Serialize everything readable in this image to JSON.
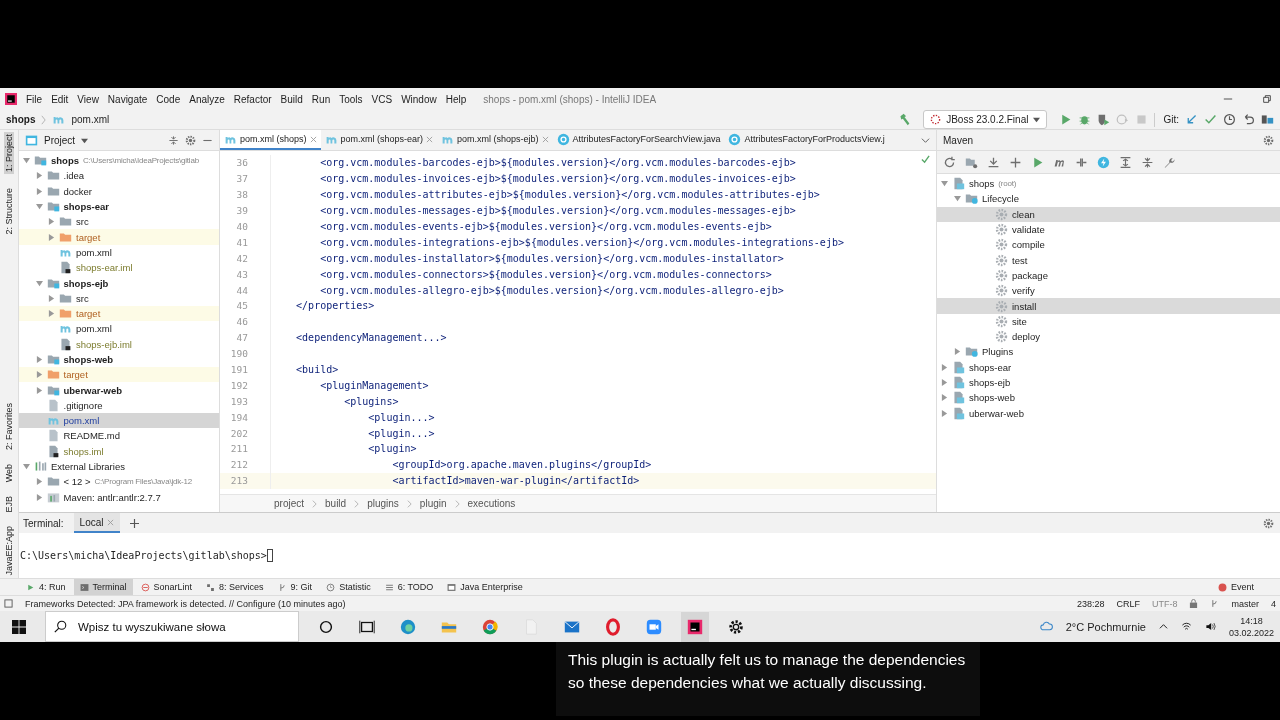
{
  "menu": [
    "File",
    "Edit",
    "View",
    "Navigate",
    "Code",
    "Analyze",
    "Refactor",
    "Build",
    "Run",
    "Tools",
    "VCS",
    "Window",
    "Help"
  ],
  "window": {
    "title": "shops - pom.xml (shops) - IntelliJ IDEA"
  },
  "navbar": {
    "project": "shops",
    "file": "pom.xml"
  },
  "run_config": "JBoss 23.0.2.Final",
  "git_label": "Git:",
  "side_strip": {
    "top": [
      {
        "label": "1: Project",
        "selected": true
      },
      {
        "label": "2: Structure",
        "selected": false
      }
    ],
    "bottom": [
      {
        "label": "2: Favorites",
        "selected": false
      },
      {
        "label": "Web",
        "selected": false
      },
      {
        "label": "EJB",
        "selected": false
      },
      {
        "label": "JavaEE:App",
        "selected": false
      }
    ]
  },
  "project": {
    "title": "Project",
    "tree": [
      {
        "label": "shops",
        "hint": "C:\\Users\\micha\\IdeaProjects\\gitlab",
        "kind": "module",
        "expanded": true,
        "selected": false,
        "children": [
          {
            "label": ".idea",
            "kind": "folder",
            "expanded": false,
            "selected": false
          },
          {
            "label": "docker",
            "kind": "folder",
            "expanded": false,
            "selected": false
          },
          {
            "label": "shops-ear",
            "kind": "module",
            "expanded": true,
            "selected": false,
            "children": [
              {
                "label": "src",
                "kind": "folder",
                "expanded": false,
                "selected": false
              },
              {
                "label": "target",
                "kind": "excluded",
                "expanded": false,
                "selected": false
              },
              {
                "label": "pom.xml",
                "kind": "maven",
                "selected": false
              },
              {
                "label": "shops-ear.iml",
                "kind": "iml",
                "selected": false
              }
            ]
          },
          {
            "label": "shops-ejb",
            "kind": "module",
            "expanded": true,
            "selected": false,
            "children": [
              {
                "label": "src",
                "kind": "folder",
                "expanded": false,
                "selected": false
              },
              {
                "label": "target",
                "kind": "excluded",
                "expanded": false,
                "selected": false
              },
              {
                "label": "pom.xml",
                "kind": "maven",
                "selected": false
              },
              {
                "label": "shops-ejb.iml",
                "kind": "iml",
                "selected": false
              }
            ]
          },
          {
            "label": "shops-web",
            "kind": "module",
            "expanded": false,
            "selected": false
          },
          {
            "label": "target",
            "kind": "excluded",
            "expanded": false,
            "selected": false
          },
          {
            "label": "uberwar-web",
            "kind": "module",
            "expanded": false,
            "selected": false
          },
          {
            "label": ".gitignore",
            "kind": "file",
            "selected": false
          },
          {
            "label": "pom.xml",
            "kind": "maven",
            "selected": true
          },
          {
            "label": "README.md",
            "kind": "file",
            "selected": false
          },
          {
            "label": "shops.iml",
            "kind": "iml",
            "selected": false
          }
        ]
      },
      {
        "label": "External Libraries",
        "kind": "libraries",
        "expanded": true,
        "selected": false,
        "children": [
          {
            "label": "< 12 >",
            "hint": "C:\\Program Files\\Java\\jdk-12",
            "kind": "folder",
            "expanded": false,
            "selected": false
          },
          {
            "label": "Maven: antlr:antlr:2.7.7",
            "kind": "library",
            "expanded": false,
            "selected": false
          }
        ]
      }
    ]
  },
  "editor": {
    "tabs": [
      {
        "label": "pom.xml (shops)",
        "kind": "maven",
        "selected": true
      },
      {
        "label": "pom.xml (shops-ear)",
        "kind": "maven",
        "selected": false
      },
      {
        "label": "pom.xml (shops-ejb)",
        "kind": "maven",
        "selected": false
      },
      {
        "label": "AttributesFactoryForSearchView.java",
        "kind": "class",
        "selected": false
      },
      {
        "label": "AttributesFactoryForProductsView.j",
        "kind": "class",
        "selected": false
      }
    ],
    "lines": [
      {
        "no": "36",
        "text": "        <org.vcm.modules-barcodes-ejb>${modules.version}</org.vcm.modules-barcodes-ejb>"
      },
      {
        "no": "37",
        "text": "        <org.vcm.modules-invoices-ejb>${modules.version}</org.vcm.modules-invoices-ejb>"
      },
      {
        "no": "38",
        "text": "        <org.vcm.modules-attributes-ejb>${modules.version}</org.vcm.modules-attributes-ejb>"
      },
      {
        "no": "39",
        "text": "        <org.vcm.modules-messages-ejb>${modules.version}</org.vcm.modules-messages-ejb>"
      },
      {
        "no": "40",
        "text": "        <org.vcm.modules-events-ejb>${modules.version}</org.vcm.modules-events-ejb>"
      },
      {
        "no": "41",
        "text": "        <org.vcm.modules-integrations-ejb>${modules.version}</org.vcm.modules-integrations-ejb>"
      },
      {
        "no": "42",
        "text": "        <org.vcm.modules-installator>${modules.version}</org.vcm.modules-installator>"
      },
      {
        "no": "43",
        "text": "        <org.vcm.modules-connectors>${modules.version}</org.vcm.modules-connectors>"
      },
      {
        "no": "44",
        "text": "        <org.vcm.modules-allegro-ejb>${modules.version}</org.vcm.modules-allegro-ejb>"
      },
      {
        "no": "45",
        "text": "    </properties>"
      },
      {
        "no": "46"
      },
      {
        "no": "47",
        "text": "    <dependencyManagement...>"
      },
      {
        "no": "190"
      },
      {
        "no": "191",
        "text": "    <build>"
      },
      {
        "no": "192",
        "text": "        <pluginManagement>"
      },
      {
        "no": "193",
        "text": "            <plugins>"
      },
      {
        "no": "194",
        "text": "                <plugin...>"
      },
      {
        "no": "202",
        "text": "                <plugin...>"
      },
      {
        "no": "211",
        "text": "                <plugin>"
      },
      {
        "no": "212",
        "text": "                    <groupId>org.apache.maven.plugins</groupId>"
      },
      {
        "no": "213",
        "text": "                    <artifactId>maven-war-plugin</artifactId>"
      }
    ],
    "breadcrumbs": [
      "project",
      "build",
      "plugins",
      "plugin",
      "executions"
    ]
  },
  "maven": {
    "title": "Maven",
    "tree": [
      {
        "label": "shops",
        "suffix": "(root)",
        "kind": "project",
        "expanded": true,
        "selected": false,
        "children": [
          {
            "label": "Lifecycle",
            "kind": "group",
            "expanded": true,
            "selected": false,
            "children": [
              {
                "label": "clean",
                "kind": "goal",
                "selected": true
              },
              {
                "label": "validate",
                "kind": "goal",
                "selected": false
              },
              {
                "label": "compile",
                "kind": "goal",
                "selected": false
              },
              {
                "label": "test",
                "kind": "goal",
                "selected": false
              },
              {
                "label": "package",
                "kind": "goal",
                "selected": false
              },
              {
                "label": "verify",
                "kind": "goal",
                "selected": false
              },
              {
                "label": "install",
                "kind": "goal",
                "selected": true
              },
              {
                "label": "site",
                "kind": "goal",
                "selected": false
              },
              {
                "label": "deploy",
                "kind": "goal",
                "selected": false
              }
            ]
          },
          {
            "label": "Plugins",
            "kind": "group",
            "expanded": false,
            "selected": false
          }
        ]
      },
      {
        "label": "shops-ear",
        "kind": "project",
        "expanded": false,
        "selected": false
      },
      {
        "label": "shops-ejb",
        "kind": "project",
        "expanded": false,
        "selected": false
      },
      {
        "label": "shops-web",
        "kind": "project",
        "expanded": false,
        "selected": false
      },
      {
        "label": "uberwar-web",
        "kind": "project",
        "expanded": false,
        "selected": false
      }
    ]
  },
  "terminal": {
    "title": "Terminal:",
    "tabs": [
      {
        "label": "Local",
        "selected": true
      }
    ],
    "prompt": "C:\\Users\\micha\\IdeaProjects\\gitlab\\shops>"
  },
  "tool_tabs": [
    {
      "label": "4: Run",
      "kind": "run",
      "selected": false
    },
    {
      "label": "Terminal",
      "kind": "terminal",
      "selected": true
    },
    {
      "label": "SonarLint",
      "kind": "sonar",
      "selected": false
    },
    {
      "label": "8: Services",
      "kind": "services",
      "selected": false
    },
    {
      "label": "9: Git",
      "kind": "git",
      "selected": false
    },
    {
      "label": "Statistic",
      "kind": "statistic",
      "selected": false
    },
    {
      "label": "6: TODO",
      "kind": "todo",
      "selected": false
    },
    {
      "label": "Java Enterprise",
      "kind": "javaee",
      "selected": false
    }
  ],
  "event_log": "Event",
  "status_bar": {
    "message": "Frameworks Detected: JPA framework is detected. // Configure (10 minutes ago)",
    "position": "238:28",
    "line_sep": "CRLF",
    "encoding": "UTF-8",
    "branch": "master",
    "extra": "4"
  },
  "taskbar": {
    "search_placeholder": "Wpisz tu wyszukiwane słowa",
    "weather": "2°C Pochmurnie",
    "time": "14:18",
    "date": "03.02.2022"
  },
  "caption": "This plugin is actually felt us to manage the dependencies so these dependencies what we actually discussing."
}
